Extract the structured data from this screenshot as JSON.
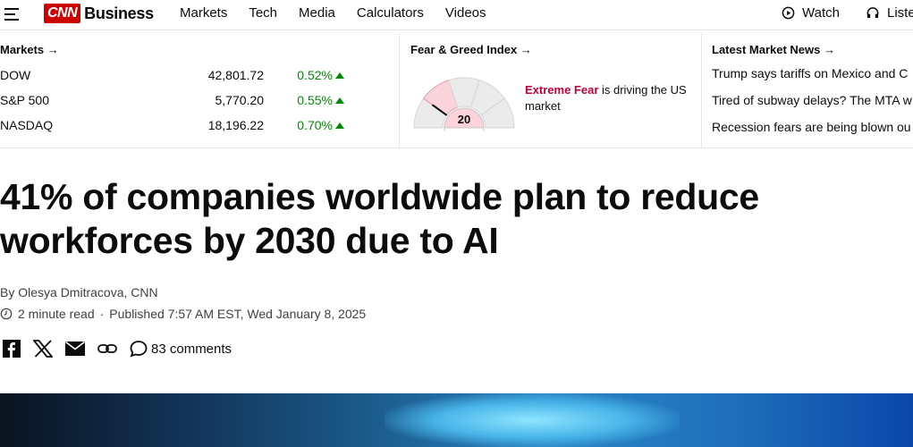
{
  "header": {
    "logo_text": "CNN",
    "section": "Business",
    "nav": [
      "Markets",
      "Tech",
      "Media",
      "Calculators",
      "Videos"
    ],
    "watch_label": "Watch",
    "listen_label": "Liste"
  },
  "markets": {
    "heading": "Markets →",
    "rows": [
      {
        "name": "DOW",
        "value": "42,801.72",
        "change": "0.52%"
      },
      {
        "name": "S&P 500",
        "value": "5,770.20",
        "change": "0.55%"
      },
      {
        "name": "NASDAQ",
        "value": "18,196.22",
        "change": "0.70%"
      }
    ]
  },
  "fear_greed": {
    "heading": "Fear & Greed Index →",
    "score": "20",
    "status": "Extreme Fear",
    "description": " is driving the US market",
    "gauge_level": 0.2
  },
  "news": {
    "heading": "Latest Market News →",
    "items": [
      "Trump says tariffs on Mexico and C",
      "Tired of subway delays? The MTA w",
      "Recession fears are being blown ou"
    ]
  },
  "article": {
    "headline": "41% of companies worldwide plan to reduce workforces by 2030 due to AI",
    "byline": "By Olesya Dmitracova, CNN",
    "read_time": "2 minute read",
    "published": "Published 7:57 AM EST, Wed January 8, 2025",
    "comments": "83 comments"
  },
  "colors": {
    "brand": "#cc0000",
    "positive": "#008a00",
    "fear": "#c0003a"
  }
}
